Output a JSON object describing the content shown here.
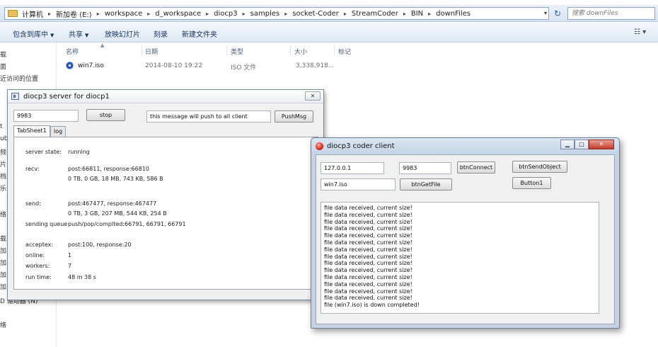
{
  "explorer": {
    "breadcrumb": [
      "计算机",
      "新加卷 (E:)",
      "workspace",
      "d_workspace",
      "diocp3",
      "samples",
      "socket-Coder",
      "StreamCoder",
      "BIN",
      "downFiles"
    ],
    "search_placeholder": "搜索 downFiles",
    "commands": [
      "包含到库中",
      "共享",
      "放映幻灯片",
      "刻录",
      "新建文件夹"
    ],
    "columns": [
      "名称",
      "日期",
      "类型",
      "大小",
      "标记"
    ],
    "files": [
      {
        "name": "win7.iso",
        "date": "2014-08-10 19:22",
        "type": "ISO 文件",
        "size": "3,338,918..."
      }
    ],
    "nav_fragments": [
      "载",
      "面",
      "近访问的位置",
      "t",
      "ub",
      "频",
      "片",
      "档",
      "乐",
      "络",
      "载",
      "加",
      "加",
      "加",
      "加",
      "D 驱动器 (N)",
      "络"
    ]
  },
  "server": {
    "title": "diocp3 server for diocp1",
    "port_value": "9983",
    "stop_label": "stop",
    "message_value": "this message will push to all client",
    "pushmsg_label": "PushMsg",
    "tabs": [
      "TabSheet1",
      "log"
    ],
    "close_glyph": "✕",
    "stats": [
      {
        "label": "server state:",
        "value": "running"
      },
      {
        "label": "recv:",
        "value": "post:66811, response:66810"
      },
      {
        "label": "",
        "value": "0 TB, 0 GB, 18 MB, 743 KB, 586 B"
      },
      {
        "label": "send:",
        "value": "post:467477, response:467477"
      },
      {
        "label": "",
        "value": "0 TB, 3 GB, 207 MB, 544 KB, 254 B"
      },
      {
        "label": "sending queue",
        "value": "push/pop/complted:66791, 66791, 66791"
      },
      {
        "label": "acceptex:",
        "value": "post:100, response:20"
      },
      {
        "label": "online:",
        "value": "1"
      },
      {
        "label": "workers:",
        "value": "7"
      },
      {
        "label": "run time:",
        "value": "48 m 38 s"
      }
    ]
  },
  "client": {
    "title": "diocp3 coder client",
    "host_value": "127.0.0.1",
    "port_value": "9983",
    "btn_connect": "btnConnect",
    "btn_send_object": "btnSendObject",
    "file_value": "win7.iso",
    "btn_get_file": "btnGetFile",
    "btn_button1": "Button1",
    "caption_min": "▁",
    "caption_max": "□",
    "caption_close": "✕",
    "log_lines": [
      "file data received, current size!",
      "file data received, current size!",
      "file data received, current size!",
      "file data received, current size!",
      "file data received, current size!",
      "file data received, current size!",
      "file data received, current size!",
      "file data received, current size!",
      "file data received, current size!",
      "file data received, current size!",
      "file data received, current size!",
      "file data received, current size!",
      "file data received, current size!",
      "file data received, current size!",
      "file (win7.iso) is down completed!"
    ]
  }
}
